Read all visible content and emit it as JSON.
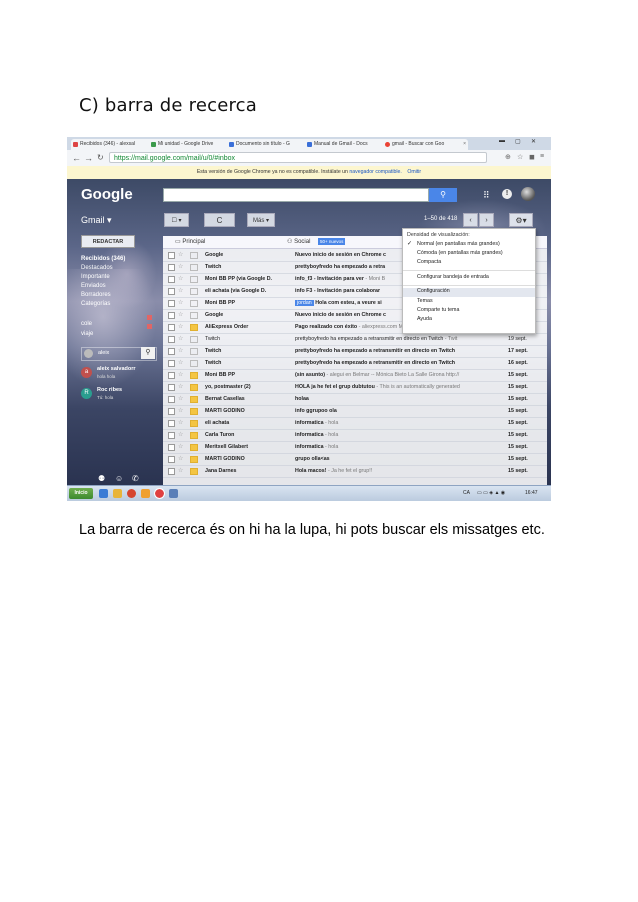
{
  "heading": "C) barra de recerca",
  "description": "La barra de recerca és on hi ha la lupa, hi pots buscar els missatges etc.",
  "screenshot": {
    "browser": {
      "tabs": [
        {
          "title": "Recibidos (346) - alexsal"
        },
        {
          "title": "Mi unidad - Google Drive"
        },
        {
          "title": "Documento sin título - G"
        },
        {
          "title": "Manual de Gmail - Docs"
        },
        {
          "title": "gmail - Buscar con Goo"
        }
      ],
      "url": "https://mail.google.com/mail/u/0/#inbox",
      "infobar": {
        "text": "Esta versión de Google Chrome ya no es compatible. Instálate un",
        "link": "navegador compatible.",
        "dismiss": "Omitir"
      }
    },
    "gmail": {
      "logo": "Google",
      "app_label": "Gmail ▾",
      "toolbar": {
        "refresh": "C",
        "more": "Más ▾",
        "page_info": "1–50 de 418"
      },
      "compose": "REDACTAR",
      "folders": [
        "Recibidos (346)",
        "Destacados",
        "Importante",
        "Enviados",
        "Borradores",
        "Categorías"
      ],
      "labels": [
        "cole",
        "viaje"
      ],
      "hangouts_user": "aleix",
      "contacts": [
        {
          "initial": "a",
          "name": "aleix salvadorr",
          "status": "hola hola"
        },
        {
          "initial": "R",
          "name": "Roc ribes",
          "status": "Tú: hola"
        }
      ],
      "tabs": {
        "primary": "Principal",
        "social": "Social",
        "social_badge": "50+ nuevos"
      },
      "rows": [
        {
          "sender": "Google",
          "subject": "Nuevo inicio de sesión en Chrome c",
          "preview": "",
          "label": "",
          "date": "",
          "read": false,
          "important": false
        },
        {
          "sender": "Twitch",
          "subject": "prettyboyfredo ha empezado a retra",
          "preview": "",
          "label": "",
          "date": "",
          "read": false,
          "important": false
        },
        {
          "sender": "Moni BB PP (via Google D.",
          "subject": "info_f3 - Invitación para ver",
          "preview": "- Moni B",
          "label": "",
          "date": "",
          "read": false,
          "important": false
        },
        {
          "sender": "eli achata (via Google D.",
          "subject": "info F3 - Invitación para colaborar",
          "preview": "",
          "label": "",
          "date": "",
          "read": false,
          "important": false
        },
        {
          "sender": "Moni BB PP",
          "subject": "Hola com esteu, a veure si",
          "preview": "",
          "label": "jordan",
          "date": "",
          "read": false,
          "important": false
        },
        {
          "sender": "Google",
          "subject": "Nuevo inicio de sesión en Chrome c",
          "preview": "",
          "label": "",
          "date": "",
          "read": false,
          "important": false
        },
        {
          "sender": "AliExpress Order",
          "subject": "Pago realizado con éxito",
          "preview": "- aliexpress.com Mis Pedidos | Ayuda | Pr",
          "label": "",
          "date": "19 sept.",
          "read": false,
          "important": true
        },
        {
          "sender": "Twitch",
          "subject": "prettyboyfredo ha empezado a retransmitir en directo en Twitch",
          "preview": "- Twit",
          "label": "",
          "date": "19 sept.",
          "read": true,
          "important": false
        },
        {
          "sender": "Twitch",
          "subject": "prettyboyfredo ha empezado a retransmitir en directo en Twitch",
          "preview": "",
          "label": "",
          "date": "17 sept.",
          "read": false,
          "important": false
        },
        {
          "sender": "Twitch",
          "subject": "prettyboyfredo ha empezado a retransmitir en directo en Twitch",
          "preview": "",
          "label": "",
          "date": "16 sept.",
          "read": false,
          "important": false
        },
        {
          "sender": "Moni BB PP",
          "subject": "(sin asunto)",
          "preview": "- alegui en Belmar -- Mónica Bieto La Salle Girona http://",
          "label": "",
          "date": "15 sept.",
          "read": false,
          "important": true
        },
        {
          "sender": "yo, postmaster (2)",
          "subject": "HOLA ja he fet el grup dubtutou",
          "preview": "- This is an automatically generated",
          "label": "",
          "date": "15 sept.",
          "read": false,
          "important": true
        },
        {
          "sender": "Bernat Casellas",
          "subject": "holaa",
          "preview": "",
          "label": "",
          "date": "15 sept.",
          "read": false,
          "important": true
        },
        {
          "sender": "MARTI GODINO",
          "subject": "info ggrupoo ola",
          "preview": "",
          "label": "",
          "date": "15 sept.",
          "read": false,
          "important": true
        },
        {
          "sender": "eli achata",
          "subject": "informatica",
          "preview": "- hola",
          "label": "",
          "date": "15 sept.",
          "read": false,
          "important": true
        },
        {
          "sender": "Carla Turon",
          "subject": "informatica",
          "preview": "- hola",
          "label": "",
          "date": "15 sept.",
          "read": false,
          "important": true
        },
        {
          "sender": "Meritxell Gilabert",
          "subject": "informatica",
          "preview": "- hola",
          "label": "",
          "date": "15 sept.",
          "read": false,
          "important": true
        },
        {
          "sender": "MARTI GODINO",
          "subject": "grupo olla<as",
          "preview": "",
          "label": "",
          "date": "15 sept.",
          "read": false,
          "important": true
        },
        {
          "sender": "Jana Darnes",
          "subject": "Hola macos!",
          "preview": "- Ja he fet el grup!!",
          "label": "",
          "date": "15 sept.",
          "read": false,
          "important": true
        }
      ],
      "settings_menu": {
        "density_header": "Densidad de visualización:",
        "density_normal": "Normal (en pantallas más grandes)",
        "density_comfortable": "Cómoda (en pantallas más grandes)",
        "density_compact": "Compacta",
        "inbox_config": "Configurar bandeja de entrada",
        "settings": "Configuración",
        "themes": "Temas",
        "share_theme": "Comparte tu tema",
        "help": "Ayuda"
      }
    },
    "taskbar": {
      "start": "Inicio",
      "lang": "CA",
      "time": "16:47"
    }
  }
}
